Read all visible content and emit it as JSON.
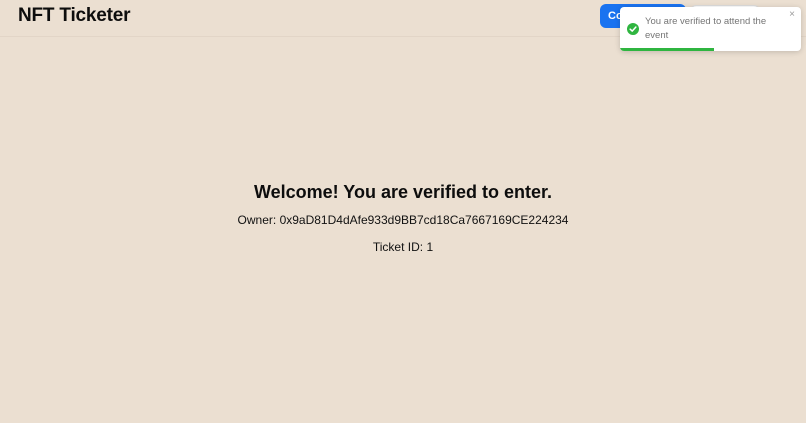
{
  "app": {
    "title": "NFT Ticketer"
  },
  "header": {
    "connect_label": "Co",
    "secondary_label": ""
  },
  "toast": {
    "message": "You are verified to attend the event",
    "icon": "check-circle-icon",
    "close_glyph": "×",
    "progress_fraction": 0.52,
    "progress_color": "#2fb540"
  },
  "main": {
    "welcome": "Welcome! You are verified to enter.",
    "owner_label": "Owner:",
    "owner_address": "0x9aD81D4dAfe933d9BB7cd18Ca7667169CE224234",
    "ticket_label": "Ticket ID:",
    "ticket_id": "1"
  },
  "colors": {
    "background": "#ebdfd1",
    "accent": "#1a73f0",
    "success": "#2fb540"
  }
}
